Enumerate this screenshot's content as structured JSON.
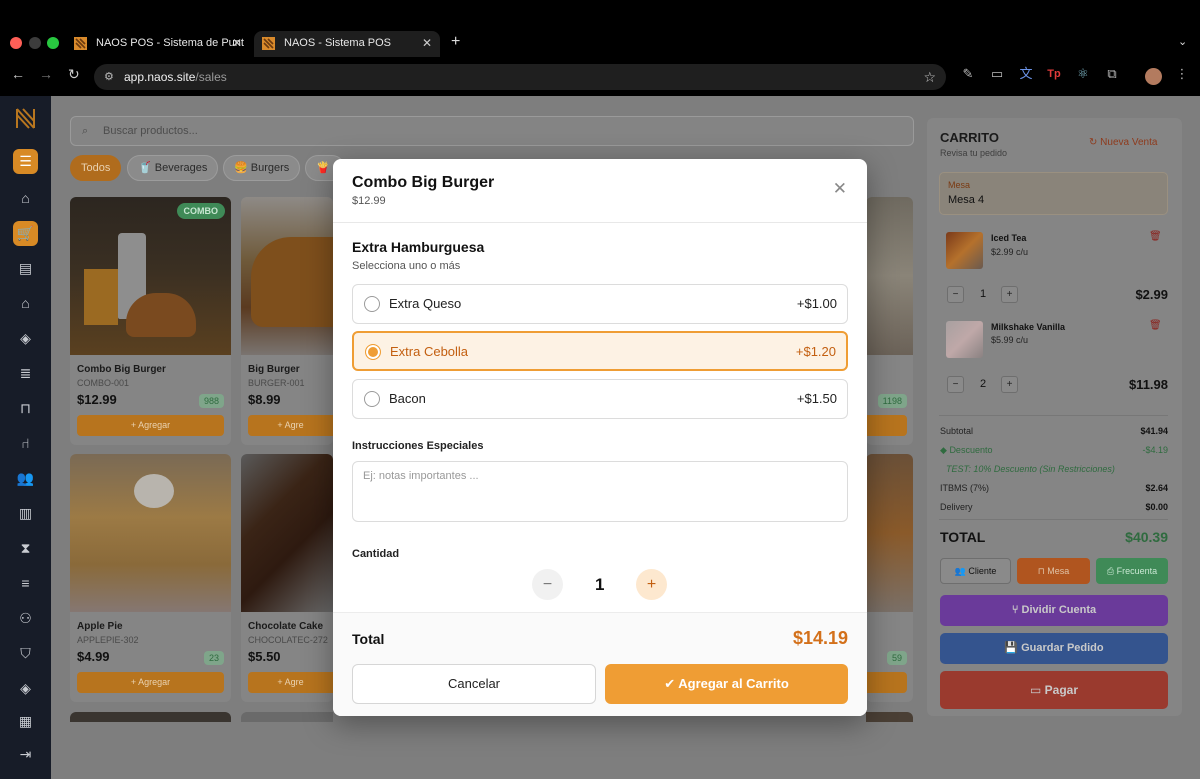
{
  "browser": {
    "tabs": [
      {
        "title": "NAOS POS - Sistema de Punt"
      },
      {
        "title": "NAOS - Sistema POS"
      }
    ],
    "url_host": "app.naos.site",
    "url_path": "/sales"
  },
  "search": {
    "placeholder": "Buscar productos..."
  },
  "categories": [
    {
      "label": "Todos"
    },
    {
      "label": "Beverages"
    },
    {
      "label": "Burgers"
    },
    {
      "label": "C"
    }
  ],
  "products": [
    {
      "name": "Combo Big Burger",
      "sku": "COMBO-001",
      "price": "$12.99",
      "stock": "988",
      "badge": "COMBO",
      "add": "+ Agregar"
    },
    {
      "name": "Big Burger",
      "sku": "BURGER-001",
      "price": "$8.99",
      "add": "+ Agre"
    },
    {
      "name": "Apple Pie",
      "sku": "APPLEPIE-302",
      "price": "$4.99",
      "stock": "23",
      "add": "+ Agregar"
    },
    {
      "name": "Chocolate Cake",
      "sku": "CHOCOLATEC-272",
      "price": "$5.50",
      "add": "+ Agre"
    },
    {
      "stock": "1198"
    },
    {
      "stock": "59"
    }
  ],
  "cart": {
    "title": "CARRITO",
    "subtitle": "Revisa tu pedido",
    "new_sale": "Nueva Venta",
    "table_label": "Mesa",
    "table_value": "Mesa 4",
    "items": [
      {
        "name": "Iced Tea",
        "unit": "$2.99 c/u",
        "qty": "1",
        "total": "$2.99"
      },
      {
        "name": "Milkshake Vanilla",
        "unit": "$5.99 c/u",
        "qty": "2",
        "total": "$11.98"
      }
    ],
    "subtotal_label": "Subtotal",
    "subtotal": "$41.94",
    "discount_label": "Descuento",
    "discount": "-$4.19",
    "discount_note": "TEST: 10% Descuento (Sin Restricciones)",
    "tax_label": "ITBMS (7%)",
    "tax": "$2.64",
    "delivery_label": "Delivery",
    "delivery": "$0.00",
    "total_label": "TOTAL",
    "total": "$40.39",
    "btn_client": "Cliente",
    "btn_table": "Mesa",
    "btn_freq": "Frecuenta",
    "btn_split": "Dividir Cuenta",
    "btn_save": "Guardar Pedido",
    "btn_pay": "Pagar"
  },
  "modal": {
    "title": "Combo Big Burger",
    "price": "$12.99",
    "section_title": "Extra Hamburguesa",
    "section_sub": "Selecciona uno o más",
    "options": [
      {
        "label": "Extra Queso",
        "price": "+$1.00",
        "selected": false
      },
      {
        "label": "Extra Cebolla",
        "price": "+$1.20",
        "selected": true
      },
      {
        "label": "Bacon",
        "price": "+$1.50",
        "selected": false
      }
    ],
    "instructions_label": "Instrucciones Especiales",
    "instructions_placeholder": "Ej: notas importantes ...",
    "qty_label": "Cantidad",
    "qty": "1",
    "total_label": "Total",
    "total": "$14.19",
    "cancel": "Cancelar",
    "add": "Agregar al Carrito"
  },
  "colors": {
    "accent": "#ef9d34",
    "sidebar": "#171c28",
    "split": "#7a3bd0",
    "save": "#3b63c8",
    "pay": "#c0392b"
  }
}
